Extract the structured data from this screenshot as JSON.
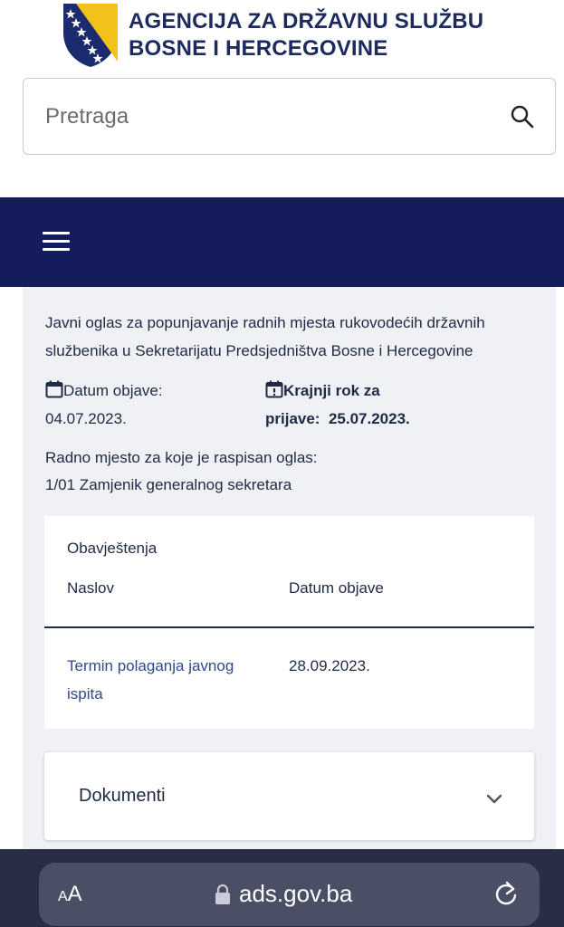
{
  "header": {
    "org_line1": "AGENCIJA ZA DRŽAVNU SLUŽBU",
    "org_line2": "BOSNE I HERCEGOVINE",
    "logo_icon": "bih-coat-of-arms-icon",
    "search_placeholder": "Pretraga",
    "search_icon": "search-icon"
  },
  "nav": {
    "menu_icon": "hamburger-menu-icon",
    "bar_color": "#141c5c"
  },
  "ad": {
    "title": "Javni oglas za popunjavanje radnih mjesta rukovodećih državnih službenika u Sekretarijatu Predsjedništva Bosne i Hercegovine",
    "published_label": "Datum objave:",
    "published_value": "04.07.2023.",
    "deadline_label": "Krajnji rok za",
    "deadline_label2": "prijave:",
    "deadline_value": "25.07.2023.",
    "position_label": "Radno mjesto za koje je raspisan oglas:",
    "position_value": "1/01 Zamjenik generalnog sekretara"
  },
  "notices": {
    "heading": "Obavještenja",
    "columns": [
      "Naslov",
      "Datum objave"
    ],
    "rows": [
      {
        "title": "Termin polaganja javnog ispita",
        "date": "28.09.2023."
      }
    ]
  },
  "documents": {
    "label": "Dokumenti",
    "chevron_icon": "chevron-down-icon"
  },
  "browser": {
    "text_size_label": "AA",
    "url": "ads.gov.ba",
    "lock_icon": "lock-icon",
    "reload_icon": "reload-icon"
  },
  "colors": {
    "accent_navy": "#141c5c",
    "link": "#2f4a8a",
    "content_bg": "#f0f1f5"
  }
}
